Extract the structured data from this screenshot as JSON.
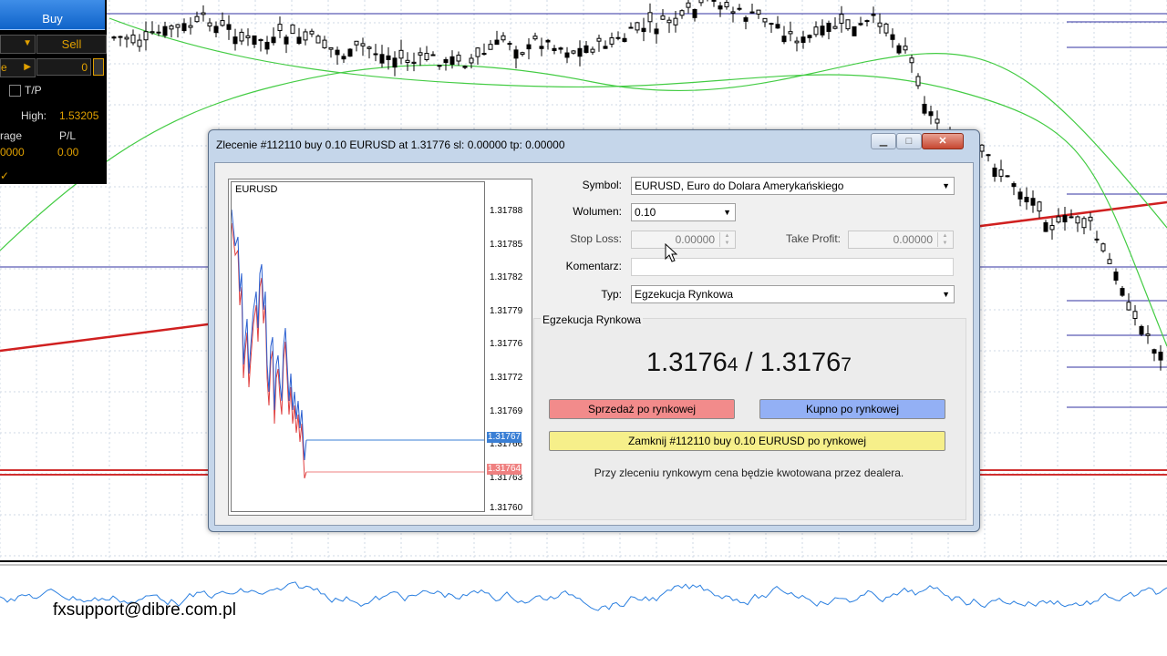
{
  "trade_panel": {
    "buy_label": "Buy",
    "sell_label": "Sell",
    "volume_partial": "",
    "sl_partial": "e",
    "field_value": "0",
    "tp_label": "T/P",
    "high_label": "High:",
    "high_value": "1.53205",
    "leverage_label": "rage",
    "pl_label": "P/L",
    "leverage_value": "0000",
    "pl_value": "0.00"
  },
  "dialog": {
    "title": "Zlecenie #112110 buy 0.10 EURUSD at 1.31776 sl: 0.00000 tp: 0.00000",
    "symbol_label": "Symbol:",
    "symbol_value": "EURUSD, Euro do Dolara Amerykańskiego",
    "volume_label": "Wolumen:",
    "volume_value": "0.10",
    "stoploss_label": "Stop Loss:",
    "stoploss_value": "0.00000",
    "takeprofit_label": "Take Profit:",
    "takeprofit_value": "0.00000",
    "comment_label": "Komentarz:",
    "comment_value": "",
    "type_label": "Typ:",
    "type_value": "Egzekucja Rynkowa",
    "group_title": "Egzekucja Rynkowa",
    "bid_main": "1.3176",
    "bid_small": "4",
    "separator": " / ",
    "ask_main": "1.3176",
    "ask_small": "7",
    "sell_button": "Sprzedaż po rynkowej",
    "buy_button": "Kupno po rynkowej",
    "close_button": "Zamknij #112110 buy 0.10 EURUSD po rynkowej",
    "note": "Przy zleceniu rynkowym cena będzie kwotowana przez dealera."
  },
  "mini_chart": {
    "symbol": "EURUSD",
    "price_ticks": [
      "1.31788",
      "1.31785",
      "1.31782",
      "1.31779",
      "1.31776",
      "1.31772",
      "1.31769",
      "1.31766",
      "1.31763",
      "1.31760"
    ],
    "ask_label": "1.31767",
    "bid_label": "1.31764"
  },
  "footer": {
    "email": "fxsupport@dibre.com.pl"
  },
  "colors": {
    "sell": "#f28b8b",
    "buy": "#93b0f5",
    "close": "#f6ef8a",
    "ask_line": "#3a7fd5",
    "bid_line": "#ef8080"
  }
}
